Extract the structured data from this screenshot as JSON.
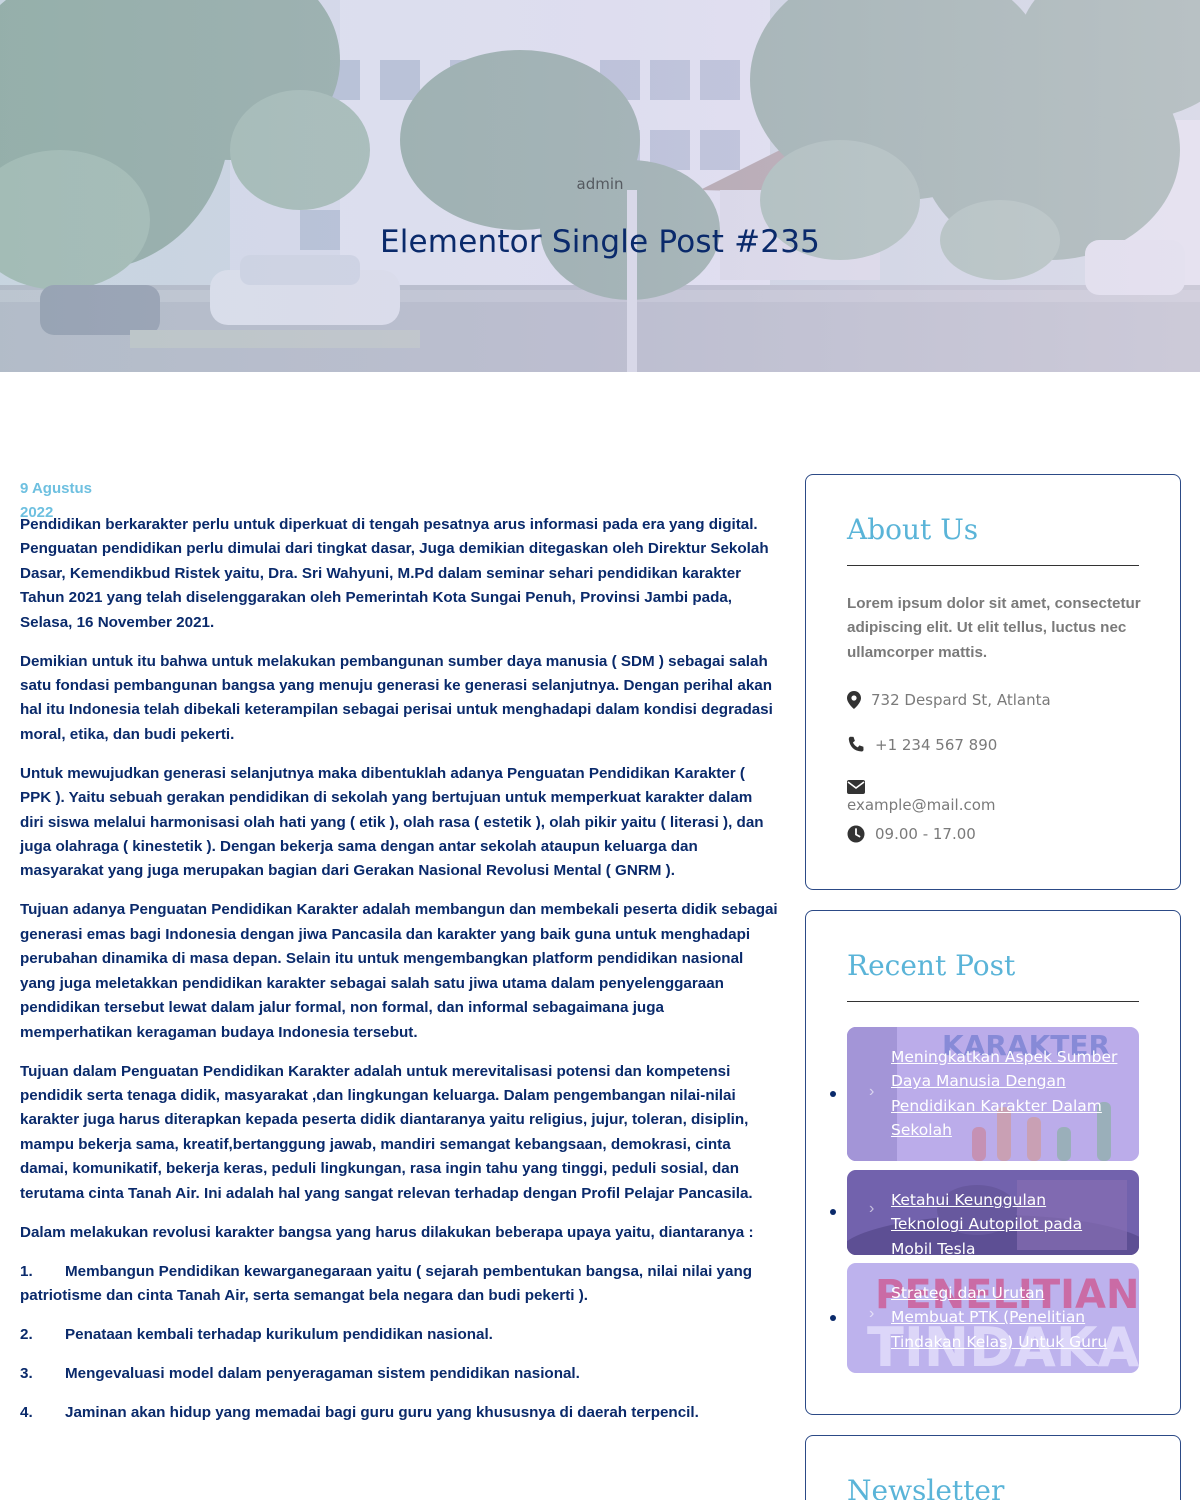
{
  "hero": {
    "author": "admin",
    "title": "Elementor Single Post #235"
  },
  "post": {
    "date_line1": "9 Agustus",
    "date_line2": "2022",
    "paragraphs": [
      "Pendidikan berkarakter perlu untuk diperkuat di tengah pesatnya arus informasi pada era yang digital. Penguatan pendidikan perlu dimulai dari tingkat dasar, Juga demikian ditegaskan oleh Direktur Sekolah Dasar, Kemendikbud Ristek yaitu, Dra. Sri Wahyuni, M.Pd dalam seminar sehari pendidikan karakter Tahun 2021 yang telah diselenggarakan oleh Pemerintah Kota Sungai Penuh, Provinsi Jambi pada, Selasa, 16 November 2021.",
      "Demikian untuk itu bahwa untuk melakukan pembangunan sumber daya manusia ( SDM ) sebagai salah satu fondasi pembangunan bangsa yang menuju generasi ke generasi selanjutnya. Dengan perihal akan hal itu Indonesia telah dibekali keterampilan sebagai perisai untuk menghadapi dalam kondisi degradasi moral, etika, dan budi pekerti.",
      "Untuk mewujudkan generasi selanjutnya maka dibentuklah adanya Penguatan Pendidikan Karakter ( PPK ). Yaitu sebuah gerakan pendidikan di sekolah yang bertujuan untuk memperkuat karakter dalam diri siswa melalui harmonisasi olah hati yang ( etik ), olah rasa ( estetik ), olah pikir yaitu ( literasi ), dan juga olahraga ( kinestetik ). Dengan bekerja sama dengan antar sekolah ataupun keluarga dan masyarakat yang juga merupakan bagian dari Gerakan Nasional Revolusi Mental ( GNRM ).",
      "Tujuan adanya Penguatan Pendidikan Karakter adalah membangun dan membekali peserta didik sebagai generasi emas bagi Indonesia dengan  jiwa Pancasila dan karakter yang baik guna untuk menghadapi perubahan dinamika di masa depan. Selain itu untuk mengembangkan platform pendidikan nasional yang juga meletakkan pendidikan karakter sebagai salah satu jiwa utama dalam penyelenggaraan pendidikan tersebut lewat dalam jalur formal, non formal, dan informal sebagaimana juga memperhatikan keragaman budaya Indonesia tersebut.",
      "Tujuan dalam Penguatan Pendidikan Karakter adalah untuk merevitalisasi potensi dan kompetensi pendidik serta tenaga didik, masyarakat ,dan lingkungan keluarga. Dalam pengembangan nilai-nilai karakter juga harus diterapkan kepada peserta didik diantaranya yaitu religius, jujur, toleran, disiplin, mampu bekerja sama, kreatif,bertanggung jawab, mandiri semangat kebangsaan, demokrasi, cinta damai, komunikatif, bekerja keras, peduli lingkungan, rasa ingin tahu yang tinggi, peduli sosial, dan terutama cinta Tanah Air. Ini adalah hal yang sangat relevan terhadap dengan Profil Pelajar Pancasila.",
      "Dalam melakukan revolusi karakter bangsa yang harus dilakukan beberapa upaya yaitu, diantaranya :"
    ],
    "list": [
      {
        "num": "1.",
        "text": "Membangun Pendidikan kewarganegaraan yaitu ( sejarah pembentukan bangsa, nilai nilai yang patriotisme dan cinta Tanah Air, serta semangat bela negara dan budi pekerti )."
      },
      {
        "num": "2.",
        "text": "Penataan kembali terhadap kurikulum pendidikan nasional."
      },
      {
        "num": "3.",
        "text": "Mengevaluasi model dalam penyeragaman sistem pendidikan nasional."
      },
      {
        "num": "4.",
        "text": "Jaminan akan hidup yang memadai bagi guru guru yang khususnya di daerah terpencil."
      }
    ]
  },
  "about": {
    "title": "About Us",
    "text": "Lorem ipsum dolor sit amet, consectetur adipiscing elit. Ut elit tellus, luctus nec ullamcorper mattis.",
    "address": "732 Despard St, Atlanta",
    "phone": "+1 234 567 890",
    "email": "example@mail.com",
    "hours": "09.00 - 17.00"
  },
  "recent": {
    "title": "Recent Post",
    "posts": [
      {
        "title": "Meningkatkan Aspek Sumber Daya Manusia Dengan Pendidikan Karakter Dalam Sekolah",
        "image_text": "KARAKTER"
      },
      {
        "title": "Ketahui Keunggulan Teknologi Autopilot pada Mobil Tesla"
      },
      {
        "title": "Strategi dan Urutan Membuat PTK (Penelitian Tindakan Kelas) Untuk Guru",
        "image_text_1": "PENELITIAN",
        "image_text_2": "TINDAKAN"
      }
    ]
  },
  "newsletter": {
    "title": "Newsletter"
  },
  "colors": {
    "primary": "#0a2a6b",
    "accent": "#5ab4d8",
    "date": "#6ec0e0",
    "border": "#2c4a86"
  }
}
